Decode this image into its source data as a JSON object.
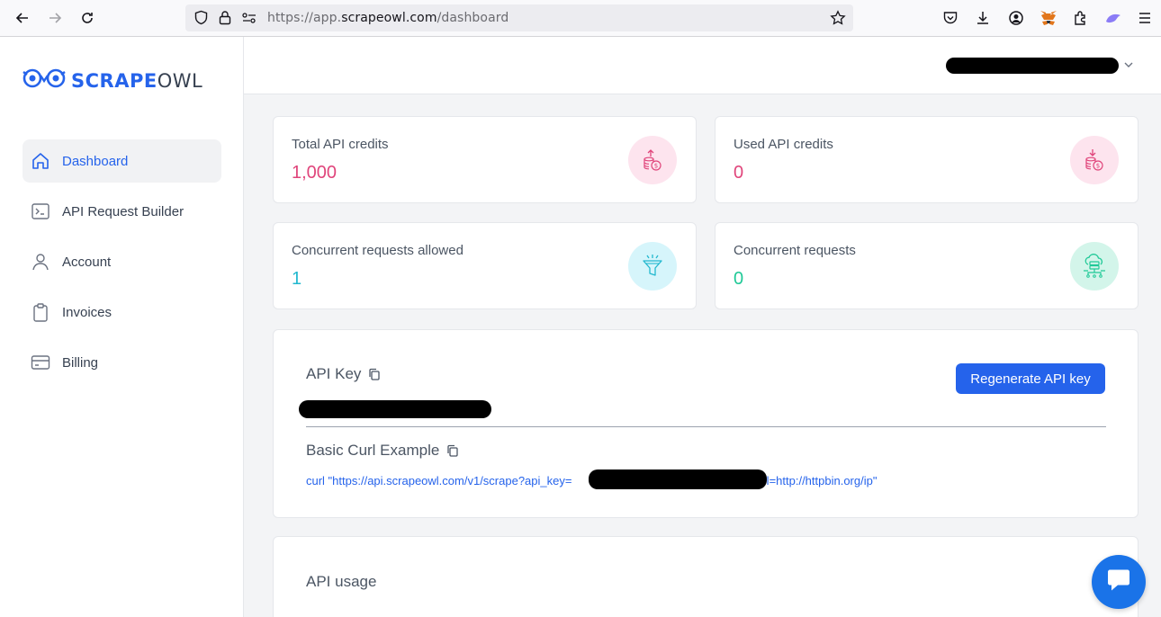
{
  "browser": {
    "url_prefix": "https://app.",
    "url_host": "scrapeowl.com",
    "url_path": "/dashboard"
  },
  "sidebar": {
    "logo_bold": "SCRAPE",
    "logo_light": "OWL",
    "items": [
      {
        "label": "Dashboard",
        "icon": "home-icon"
      },
      {
        "label": "API Request Builder",
        "icon": "terminal-icon"
      },
      {
        "label": "Account",
        "icon": "user-icon"
      },
      {
        "label": "Invoices",
        "icon": "clipboard-icon"
      },
      {
        "label": "Billing",
        "icon": "credit-card-icon"
      }
    ]
  },
  "stats": [
    {
      "label": "Total API credits",
      "value": "1,000",
      "color": "#e0457b"
    },
    {
      "label": "Used API credits",
      "value": "0",
      "color": "#e0457b"
    },
    {
      "label": "Concurrent requests allowed",
      "value": "1",
      "color": "#22b8cf"
    },
    {
      "label": "Concurrent requests",
      "value": "0",
      "color": "#20c997"
    }
  ],
  "api_key": {
    "title": "API Key",
    "regenerate_label": "Regenerate API key",
    "curl_title": "Basic Curl Example",
    "curl_prefix": "curl \"https://api.scrapeowl.com/v1/scrape?api_key=",
    "curl_suffix": "&url=http://httpbin.org/ip\""
  },
  "usage": {
    "title": "API usage"
  },
  "colors": {
    "accent": "#2563eb"
  }
}
